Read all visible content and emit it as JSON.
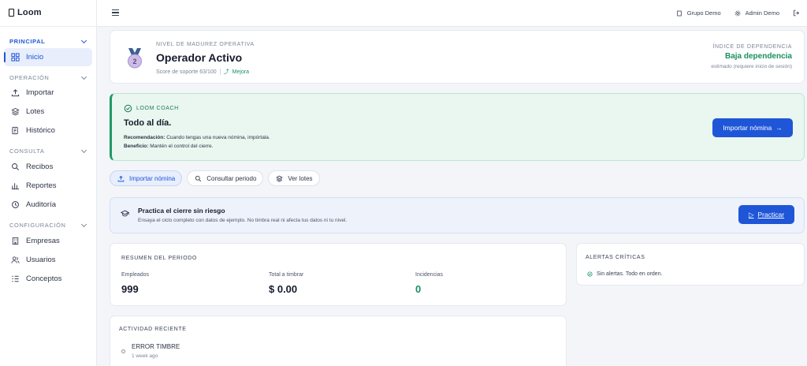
{
  "brand": {
    "name": "Loom"
  },
  "sidebar": {
    "sections": [
      {
        "label": "PRINCIPAL",
        "active": true
      },
      {
        "label": "OPERACIÓN"
      },
      {
        "label": "CONSULTA"
      },
      {
        "label": "CONFIGURACIÓN"
      }
    ],
    "items": [
      {
        "label": "Inicio",
        "icon": "grid-icon",
        "active": true
      },
      {
        "label": "Importar",
        "icon": "upload-icon"
      },
      {
        "label": "Lotes",
        "icon": "layers-icon"
      },
      {
        "label": "Histórico",
        "icon": "history-icon"
      },
      {
        "label": "Recibos",
        "icon": "search-icon"
      },
      {
        "label": "Reportes",
        "icon": "bar-chart-icon"
      },
      {
        "label": "Auditoría",
        "icon": "audit-clock-icon"
      },
      {
        "label": "Empresas",
        "icon": "building-icon"
      },
      {
        "label": "Usuarios",
        "icon": "users-icon"
      },
      {
        "label": "Conceptos",
        "icon": "list-icon"
      }
    ]
  },
  "topbar": {
    "group": "Grupo Demo",
    "user": "Admin Demo"
  },
  "level": {
    "kicker": "NIVEL DE MADUREZ OPERATIVA",
    "title": "Operador Activo",
    "badge_number": "2",
    "score": "Score de soporte 63/100",
    "trend": "Mejora",
    "dependency_label": "ÍNDICE DE DEPENDENCIA",
    "dependency_value": "Baja dependencia",
    "dependency_note": "estimado (requiere inicio de sesión)"
  },
  "coach": {
    "tag": "LOOM COACH",
    "title": "Todo al día.",
    "recommendation_label": "Recomendación:",
    "recommendation": "Cuando tengas una nueva nómina, impórtala.",
    "benefit_label": "Beneficio:",
    "benefit": "Mantén el control del cierre.",
    "button": "Importar nómina"
  },
  "quick_actions": [
    {
      "label": "Importar nómina",
      "icon": "upload-icon"
    },
    {
      "label": "Consultar periodo",
      "icon": "search-icon"
    },
    {
      "label": "Ver lotes",
      "icon": "layers-icon"
    }
  ],
  "practice": {
    "title": "Practica el cierre sin riesgo",
    "subtitle": "Ensaya el ciclo completo con datos de ejemplo. No timbra real ni afecta tus datos ni tu nivel.",
    "button": "Practicar"
  },
  "summary": {
    "title": "RESUMEN DEL PERIODO",
    "stats": [
      {
        "label": "Empleados",
        "value": "999"
      },
      {
        "label": "Total a timbrar",
        "value": "$ 0.00"
      },
      {
        "label": "Incidencias",
        "value": "0"
      }
    ]
  },
  "alerts": {
    "title": "ALERTAS CRÍTICAS",
    "message": "Sin alertas. Todo en orden."
  },
  "activity": {
    "title": "ACTIVIDAD RECIENTE",
    "items": [
      {
        "title": "ERROR TIMBRE",
        "time": "1 week ago"
      }
    ]
  },
  "colors": {
    "accent": "#1f56d8",
    "success": "#19905f",
    "coach_bg": "#e9f7f0"
  }
}
